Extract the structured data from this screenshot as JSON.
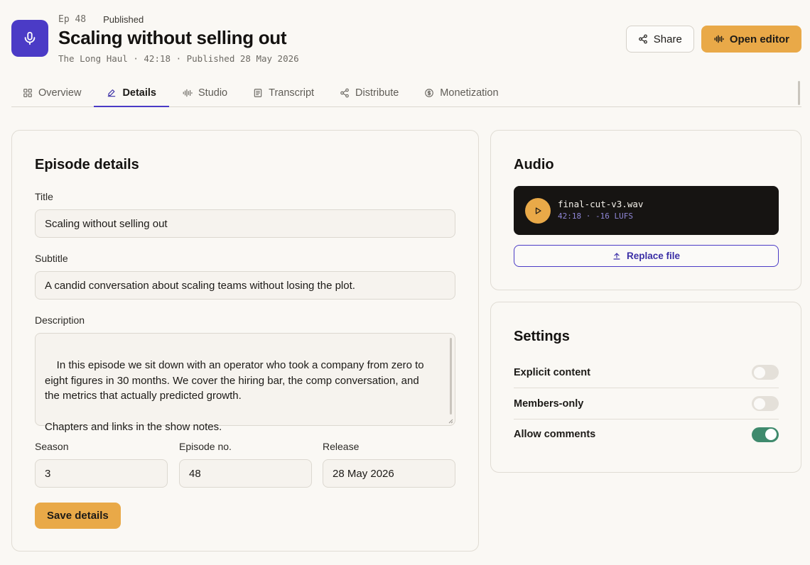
{
  "header": {
    "episode_number": "Ep 48",
    "status": "Published",
    "title": "Scaling without selling out",
    "meta": "The Long Haul · 42:18 · Published 28 May 2026",
    "share_label": "Share",
    "editor_label": "Open editor"
  },
  "tabs": [
    {
      "label": "Overview",
      "icon": "grid-icon"
    },
    {
      "label": "Details",
      "icon": "pen-icon",
      "active": true
    },
    {
      "label": "Studio",
      "icon": "waveform-icon"
    },
    {
      "label": "Transcript",
      "icon": "document-icon"
    },
    {
      "label": "Distribute",
      "icon": "share-nodes-icon"
    },
    {
      "label": "Monetization",
      "icon": "dollar-circle-icon"
    }
  ],
  "details": {
    "heading": "Episode details",
    "title_label": "Title",
    "title_value": "Scaling without selling out",
    "subtitle_label": "Subtitle",
    "subtitle_value": "A candid conversation about scaling teams without losing the plot.",
    "description_label": "Description",
    "description_value": "In this episode we sit down with an operator who took a company from zero to\neight figures in 30 months. We cover the hiring bar, the comp conversation, and\nthe metrics that actually predicted growth.\n\nChapters and links in the show notes.",
    "season_label": "Season",
    "season_value": "3",
    "episode_label": "Episode no.",
    "episode_value": "48",
    "release_label": "Release",
    "release_value": "28 May 2026",
    "save_label": "Save details"
  },
  "audio": {
    "heading": "Audio",
    "file_name": "final-cut-v3.wav",
    "file_meta": "42:18 · -16 LUFS",
    "replace_label": "Replace file"
  },
  "settings": {
    "heading": "Settings",
    "items": [
      {
        "label": "Explicit content",
        "enabled": false
      },
      {
        "label": "Members-only",
        "enabled": false
      },
      {
        "label": "Allow comments",
        "enabled": true
      }
    ]
  },
  "colors": {
    "brand": "#4b3bc6",
    "accent": "#e9a948",
    "toggle_on": "#3f8a6d",
    "background": "#faf8f4"
  }
}
